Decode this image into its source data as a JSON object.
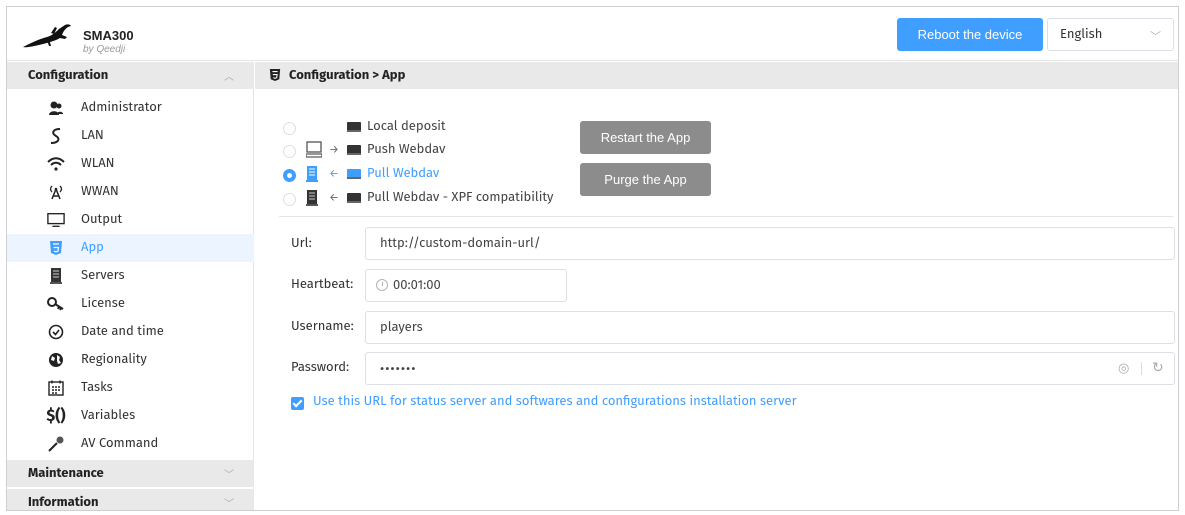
{
  "header": {
    "app_name": "SMA300",
    "app_subtitle": "by Qeedji",
    "reboot_label": "Reboot the device",
    "language_value": "English"
  },
  "sidebar": {
    "configuration_label": "Configuration",
    "items": [
      {
        "label": "Administrator",
        "icon": "administrator-icon"
      },
      {
        "label": "LAN",
        "icon": "lan-icon"
      },
      {
        "label": "WLAN",
        "icon": "wifi-icon"
      },
      {
        "label": "WWAN",
        "icon": "antenna-icon"
      },
      {
        "label": "Output",
        "icon": "monitor-icon"
      },
      {
        "label": "App",
        "icon": "html5-icon"
      },
      {
        "label": "Servers",
        "icon": "server-icon"
      },
      {
        "label": "License",
        "icon": "key-icon"
      },
      {
        "label": "Date and time",
        "icon": "clock-icon"
      },
      {
        "label": "Regionality",
        "icon": "globe-icon"
      },
      {
        "label": "Tasks",
        "icon": "calendar-icon"
      },
      {
        "label": "Variables",
        "icon": "variables-icon"
      },
      {
        "label": "AV Command",
        "icon": "microphone-icon"
      }
    ],
    "active_item": "App",
    "maintenance_label": "Maintenance",
    "information_label": "Information"
  },
  "main": {
    "breadcrumb": "Configuration > App",
    "modes": [
      {
        "label": "Local deposit",
        "checked": false
      },
      {
        "label": "Push Webdav",
        "checked": false
      },
      {
        "label": "Pull Webdav",
        "checked": true
      },
      {
        "label": "Pull Webdav - XPF compatibility",
        "checked": false
      }
    ],
    "restart_label": "Restart the App",
    "purge_label": "Purge the App",
    "url_label": "Url:",
    "url_value": "http://custom-domain-url/",
    "heartbeat_label": "Heartbeat:",
    "heartbeat_value": "00:01:00",
    "username_label": "Username:",
    "username_value": "players",
    "password_label": "Password:",
    "password_value": "•••••••",
    "use_url_label": "Use this URL for status server and softwares and configurations installation server"
  },
  "colors": {
    "accent": "#409eff",
    "gray_button": "#8c8c8c",
    "section_bg": "#e9e9e9"
  }
}
